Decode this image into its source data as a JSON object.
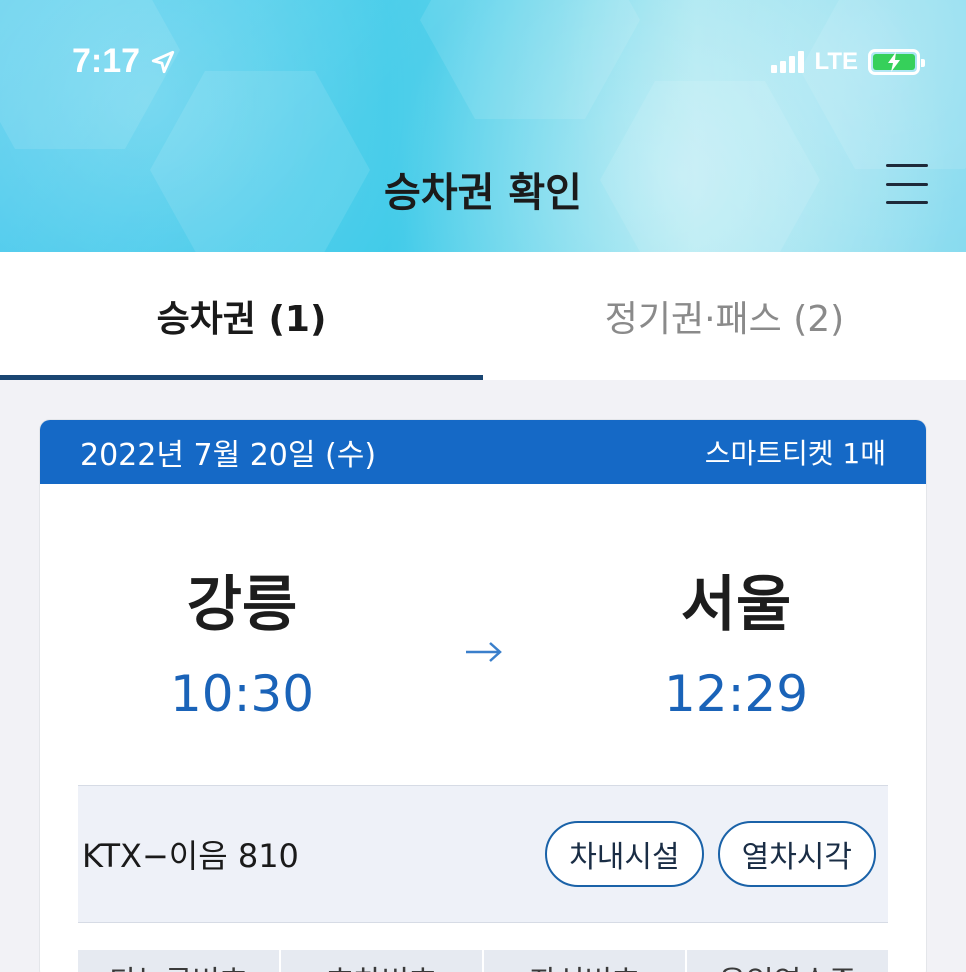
{
  "status_bar": {
    "time": "7:17",
    "network": "LTE"
  },
  "header": {
    "title": "승차권 확인"
  },
  "tabs": [
    {
      "label": "승차권 (1)",
      "active": true
    },
    {
      "label": "정기권·패스 (2)",
      "active": false
    }
  ],
  "ticket": {
    "date": "2022년 7월 20일 (수)",
    "ticket_type": "스마트티켓 1매",
    "departure": {
      "station": "강릉",
      "time": "10:30"
    },
    "arrival": {
      "station": "서울",
      "time": "12:29"
    },
    "train": "KTX−이음 810",
    "buttons": {
      "facilities": "차내시설",
      "timetable": "열차시각"
    },
    "columns": [
      "타는곳번호",
      "호차번호",
      "좌석번호",
      "운임영수증"
    ]
  },
  "colors": {
    "accent": "#1569c6",
    "time_blue": "#1a63b8",
    "tab_underline": "#1a4672",
    "battery": "#36d05a"
  }
}
